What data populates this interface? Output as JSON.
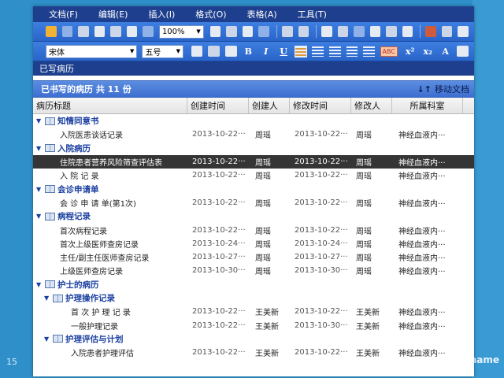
{
  "slide": {
    "number": "15",
    "brand_text": "name"
  },
  "menu": [
    "文档(F)",
    "编辑(E)",
    "插入(I)",
    "格式(O)",
    "表格(A)",
    "工具(T)"
  ],
  "toolbar": {
    "zoom": "100%"
  },
  "format_toolbar": {
    "font": "宋体",
    "size": "五号",
    "bold": "B",
    "italic": "I",
    "underline": "U",
    "spell": "ABC",
    "superscript": "x²",
    "subscript": "x₂",
    "font_color": "A"
  },
  "pane": {
    "title": "已写病历",
    "summary": "已书写的病历  共 11 份",
    "move_label": "移动文档",
    "columns": [
      "病历标题",
      "创建时间",
      "创建人",
      "修改时间",
      "修改人",
      "所属科室"
    ]
  },
  "rows": [
    {
      "kind": "group",
      "indent": 0,
      "title": "知情同意书"
    },
    {
      "kind": "doc",
      "indent": 2,
      "title": "入院医患谈话记录",
      "created": "2013-10-22···",
      "creator": "周瑶",
      "modified": "2013-10-22···",
      "modifier": "周瑶",
      "dept": "神经血液内···"
    },
    {
      "kind": "group",
      "indent": 0,
      "title": "入院病历"
    },
    {
      "kind": "doc",
      "indent": 2,
      "selected": true,
      "title": "住院患者营养风险筛查评估表",
      "created": "2013-10-22···",
      "creator": "周瑶",
      "modified": "2013-10-22···",
      "modifier": "周瑶",
      "dept": "神经血液内···"
    },
    {
      "kind": "doc",
      "indent": 2,
      "title": "入 院 记 录",
      "created": "2013-10-22···",
      "creator": "周瑶",
      "modified": "2013-10-22···",
      "modifier": "周瑶",
      "dept": "神经血液内···"
    },
    {
      "kind": "group",
      "indent": 0,
      "title": "会诊申请单"
    },
    {
      "kind": "doc",
      "indent": 2,
      "title": "会 诊 申 请 单(第1次)",
      "created": "2013-10-22···",
      "creator": "周瑶",
      "modified": "2013-10-22···",
      "modifier": "周瑶",
      "dept": "神经血液内···"
    },
    {
      "kind": "group",
      "indent": 0,
      "title": "病程记录"
    },
    {
      "kind": "doc",
      "indent": 2,
      "title": "首次病程记录",
      "created": "2013-10-22···",
      "creator": "周瑶",
      "modified": "2013-10-22···",
      "modifier": "周瑶",
      "dept": "神经血液内···"
    },
    {
      "kind": "doc",
      "indent": 2,
      "title": "首次上级医师查房记录",
      "created": "2013-10-24···",
      "creator": "周瑶",
      "modified": "2013-10-24···",
      "modifier": "周瑶",
      "dept": "神经血液内···"
    },
    {
      "kind": "doc",
      "indent": 2,
      "title": "主任/副主任医师查房记录",
      "created": "2013-10-27···",
      "creator": "周瑶",
      "modified": "2013-10-27···",
      "modifier": "周瑶",
      "dept": "神经血液内···"
    },
    {
      "kind": "doc",
      "indent": 2,
      "title": "上级医师查房记录",
      "created": "2013-10-30···",
      "creator": "周瑶",
      "modified": "2013-10-30···",
      "modifier": "周瑶",
      "dept": "神经血液内···"
    },
    {
      "kind": "group",
      "indent": 0,
      "title": "护士的病历"
    },
    {
      "kind": "group",
      "indent": 1,
      "title": "护理操作记录"
    },
    {
      "kind": "doc",
      "indent": 3,
      "title": "首 次 护 理 记 录",
      "created": "2013-10-22···",
      "creator": "王美新",
      "modified": "2013-10-22···",
      "modifier": "王美新",
      "dept": "神经血液内···"
    },
    {
      "kind": "doc",
      "indent": 3,
      "title": "一般护理记录",
      "created": "2013-10-22···",
      "creator": "王美新",
      "modified": "2013-10-30···",
      "modifier": "王美新",
      "dept": "神经血液内···"
    },
    {
      "kind": "group",
      "indent": 1,
      "title": "护理评估与计划"
    },
    {
      "kind": "doc",
      "indent": 3,
      "title": "入院患者护理评估",
      "created": "2013-10-22···",
      "creator": "王美新",
      "modified": "2013-10-22···",
      "modifier": "王美新",
      "dept": "神经血液内···"
    }
  ]
}
